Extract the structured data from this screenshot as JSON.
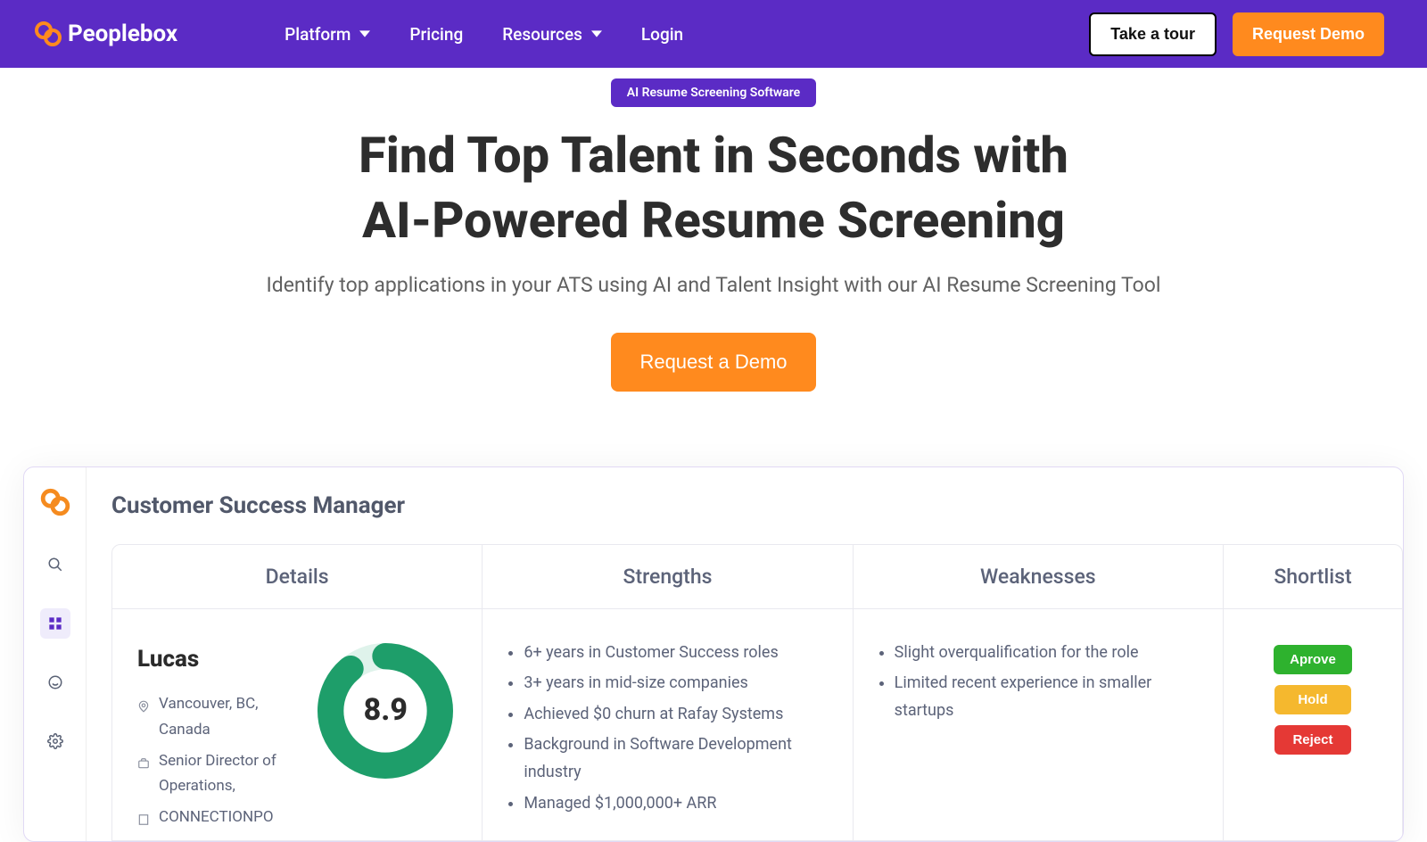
{
  "brand": "Peoplebox",
  "nav": {
    "items": [
      "Platform",
      "Pricing",
      "Resources",
      "Login"
    ],
    "tour": "Take a tour",
    "demo": "Request Demo"
  },
  "hero": {
    "badge": "AI Resume Screening Software",
    "title_line1": "Find Top Talent in Seconds with",
    "title_line2": "AI-Powered Resume Screening",
    "subtitle": "Identify top applications in your ATS using AI and Talent Insight with our AI Resume Screening Tool",
    "cta": "Request a Demo"
  },
  "preview": {
    "section_title": "Customer Success Manager",
    "columns": {
      "details": "Details",
      "strengths": "Strengths",
      "weaknesses": "Weaknesses",
      "shortlist": "Shortlist"
    },
    "candidate": {
      "name": "Lucas",
      "location": "Vancouver, BC, Canada",
      "title": "Senior Director of Operations,",
      "company": "CONNECTIONPO",
      "score": "8.9",
      "score_pct": 89
    },
    "strengths": [
      "6+ years in Customer Success roles",
      "3+ years in mid-size companies",
      "Achieved $0 churn at Rafay Systems",
      "Background in Software Development industry",
      "Managed $1,000,000+ ARR"
    ],
    "weaknesses": [
      "Slight overqualification for the role",
      "Limited recent experience in smaller startups"
    ],
    "actions": {
      "approve": "Aprove",
      "hold": "Hold",
      "reject": "Reject"
    }
  }
}
